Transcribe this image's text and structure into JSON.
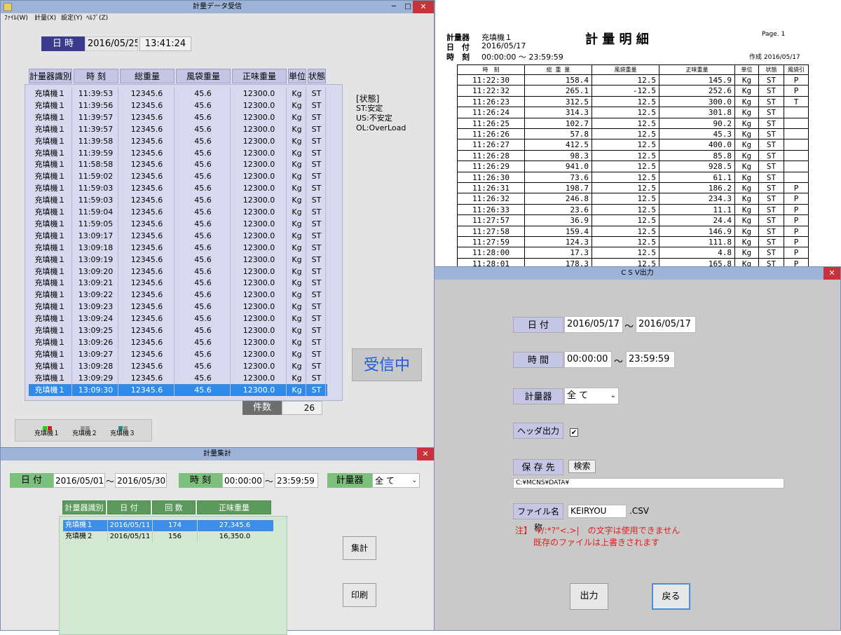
{
  "receive_window": {
    "title": "計量データ受信",
    "menu": [
      "ﾌｧｲﾙ(W)",
      "計量(X)",
      "設定(Y)",
      "ﾍﾙﾌﾟ(Z)"
    ],
    "datetime_label": "日 時",
    "date": "2016/05/25",
    "time": "13:41:24",
    "columns": [
      "計量器識別",
      "時 刻",
      "総重量",
      "風袋重量",
      "正味重量",
      "単位",
      "状態"
    ],
    "rows": [
      [
        "充填機１",
        "11:39:53",
        "12345.6",
        "45.6",
        "12300.0",
        "Kg",
        "ST"
      ],
      [
        "充填機１",
        "11:39:56",
        "12345.6",
        "45.6",
        "12300.0",
        "Kg",
        "ST"
      ],
      [
        "充填機１",
        "11:39:57",
        "12345.6",
        "45.6",
        "12300.0",
        "Kg",
        "ST"
      ],
      [
        "充填機１",
        "11:39:57",
        "12345.6",
        "45.6",
        "12300.0",
        "Kg",
        "ST"
      ],
      [
        "充填機１",
        "11:39:58",
        "12345.6",
        "45.6",
        "12300.0",
        "Kg",
        "ST"
      ],
      [
        "充填機１",
        "11:39:59",
        "12345.6",
        "45.6",
        "12300.0",
        "Kg",
        "ST"
      ],
      [
        "充填機１",
        "11:58:58",
        "12345.6",
        "45.6",
        "12300.0",
        "Kg",
        "ST"
      ],
      [
        "充填機１",
        "11:59:02",
        "12345.6",
        "45.6",
        "12300.0",
        "Kg",
        "ST"
      ],
      [
        "充填機１",
        "11:59:03",
        "12345.6",
        "45.6",
        "12300.0",
        "Kg",
        "ST"
      ],
      [
        "充填機１",
        "11:59:03",
        "12345.6",
        "45.6",
        "12300.0",
        "Kg",
        "ST"
      ],
      [
        "充填機１",
        "11:59:04",
        "12345.6",
        "45.6",
        "12300.0",
        "Kg",
        "ST"
      ],
      [
        "充填機１",
        "11:59:05",
        "12345.6",
        "45.6",
        "12300.0",
        "Kg",
        "ST"
      ],
      [
        "充填機１",
        "13:09:17",
        "12345.6",
        "45.6",
        "12300.0",
        "Kg",
        "ST"
      ],
      [
        "充填機１",
        "13:09:18",
        "12345.6",
        "45.6",
        "12300.0",
        "Kg",
        "ST"
      ],
      [
        "充填機１",
        "13:09:19",
        "12345.6",
        "45.6",
        "12300.0",
        "Kg",
        "ST"
      ],
      [
        "充填機１",
        "13:09:20",
        "12345.6",
        "45.6",
        "12300.0",
        "Kg",
        "ST"
      ],
      [
        "充填機１",
        "13:09:21",
        "12345.6",
        "45.6",
        "12300.0",
        "Kg",
        "ST"
      ],
      [
        "充填機１",
        "13:09:22",
        "12345.6",
        "45.6",
        "12300.0",
        "Kg",
        "ST"
      ],
      [
        "充填機１",
        "13:09:23",
        "12345.6",
        "45.6",
        "12300.0",
        "Kg",
        "ST"
      ],
      [
        "充填機１",
        "13:09:24",
        "12345.6",
        "45.6",
        "12300.0",
        "Kg",
        "ST"
      ],
      [
        "充填機１",
        "13:09:25",
        "12345.6",
        "45.6",
        "12300.0",
        "Kg",
        "ST"
      ],
      [
        "充填機１",
        "13:09:26",
        "12345.6",
        "45.6",
        "12300.0",
        "Kg",
        "ST"
      ],
      [
        "充填機１",
        "13:09:27",
        "12345.6",
        "45.6",
        "12300.0",
        "Kg",
        "ST"
      ],
      [
        "充填機１",
        "13:09:28",
        "12345.6",
        "45.6",
        "12300.0",
        "Kg",
        "ST"
      ],
      [
        "充填機１",
        "13:09:29",
        "12345.6",
        "45.6",
        "12300.0",
        "Kg",
        "ST"
      ],
      [
        "充填機１",
        "13:09:30",
        "12345.6",
        "45.6",
        "12300.0",
        "Kg",
        "ST"
      ]
    ],
    "selected_row": 25,
    "status_legend": [
      "[状態]",
      "ST:安定",
      "US:不安定",
      "OL:OverLoad"
    ],
    "count_label": "件数",
    "count_value": "26",
    "receiving_label": "受信中",
    "machines": [
      {
        "name": "充填機１",
        "color_a": "#22cc22",
        "color_b": "#cc2222"
      },
      {
        "name": "充填機２",
        "color_a": "#999999",
        "color_b": "#999999"
      },
      {
        "name": "充填機３",
        "color_a": "#228888",
        "color_b": "#999999"
      }
    ],
    "colors": {
      "selected": "#2f8ae8",
      "header": "#c5c5e5",
      "list_bg": "#d8d8ee",
      "label_bg": "#3a3a8e"
    }
  },
  "report": {
    "title": "計 量 明 細",
    "page": "Page. 1",
    "meter_label": "計量器",
    "meter_value": "充填機１",
    "date_label": "日　付",
    "date_value": "2016/05/17",
    "time_label": "時　刻",
    "time_value": "00:00:00 ～ 23:59:59",
    "created": "作成 2016/05/17",
    "columns": [
      "時　刻",
      "総 重 量",
      "風袋重量",
      "正味重量",
      "単位",
      "状態",
      "風袋引"
    ],
    "rows": [
      [
        "11:22:30",
        "158.4",
        "12.5",
        "145.9",
        "Kg",
        "ST",
        "P"
      ],
      [
        "11:22:32",
        "265.1",
        "-12.5",
        "252.6",
        "Kg",
        "ST",
        "P"
      ],
      [
        "11:26:23",
        "312.5",
        "12.5",
        "300.0",
        "Kg",
        "ST",
        "T"
      ],
      [
        "11:26:24",
        "314.3",
        "12.5",
        "301.8",
        "Kg",
        "ST",
        ""
      ],
      [
        "11:26:25",
        "102.7",
        "12.5",
        "90.2",
        "Kg",
        "ST",
        ""
      ],
      [
        "11:26:26",
        "57.8",
        "12.5",
        "45.3",
        "Kg",
        "ST",
        ""
      ],
      [
        "11:26:27",
        "412.5",
        "12.5",
        "400.0",
        "Kg",
        "ST",
        ""
      ],
      [
        "11:26:28",
        "98.3",
        "12.5",
        "85.8",
        "Kg",
        "ST",
        ""
      ],
      [
        "11:26:29",
        "941.0",
        "12.5",
        "928.5",
        "Kg",
        "ST",
        ""
      ],
      [
        "11:26:30",
        "73.6",
        "12.5",
        "61.1",
        "Kg",
        "ST",
        ""
      ],
      [
        "11:26:31",
        "198.7",
        "12.5",
        "186.2",
        "Kg",
        "ST",
        "P"
      ],
      [
        "11:26:32",
        "246.8",
        "12.5",
        "234.3",
        "Kg",
        "ST",
        "P"
      ],
      [
        "11:26:33",
        "23.6",
        "12.5",
        "11.1",
        "Kg",
        "ST",
        "P"
      ],
      [
        "11:27:57",
        "36.9",
        "12.5",
        "24.4",
        "Kg",
        "ST",
        "P"
      ],
      [
        "11:27:58",
        "159.4",
        "12.5",
        "146.9",
        "Kg",
        "ST",
        "P"
      ],
      [
        "11:27:59",
        "124.3",
        "12.5",
        "111.8",
        "Kg",
        "ST",
        "P"
      ],
      [
        "11:28:00",
        "17.3",
        "12.5",
        "4.8",
        "Kg",
        "ST",
        "P"
      ],
      [
        "11:28:01",
        "178.3",
        "12.5",
        "165.8",
        "Kg",
        "ST",
        "P"
      ]
    ]
  },
  "summary": {
    "title": "計量集計",
    "date_label": "日 付",
    "date_from": "2016/05/01",
    "date_to": "2016/05/30",
    "time_label": "時 刻",
    "time_from": "00:00:00",
    "time_to": "23:59:59",
    "meter_label": "計量器",
    "meter_value": "全 て",
    "tilde": "～",
    "columns": [
      "計量器識別",
      "日 付",
      "回 数",
      "正味重量"
    ],
    "rows": [
      [
        "充填機１",
        "2016/05/11",
        "174",
        "27,345.6"
      ],
      [
        "充填機２",
        "2016/05/11",
        "156",
        "16,350.0"
      ]
    ],
    "aggregate_button": "集計",
    "print_button": "印刷",
    "colors": {
      "label_bg": "#7dbf7d",
      "list_bg": "#d3e8d3",
      "selected": "#3d8ee8"
    }
  },
  "csv": {
    "title": "C S V出力",
    "date_label": "日 付",
    "date_from": "2016/05/17",
    "date_to": "2016/05/17",
    "time_label": "時 間",
    "time_from": "00:00:00",
    "time_to": "23:59:59",
    "meter_label": "計量器",
    "meter_value": "全 て",
    "header_label": "ヘッダ出力",
    "header_checked": "✔",
    "save_label": "保 存 先",
    "search_button": "検索",
    "save_path": "C:¥MCNS¥DATA¥",
    "filename_label": "ファイル名称",
    "filename_value": "KEIRYOU",
    "extension": ".CSV",
    "note_1": "注】　¥/:*?\"<.>|　の文字は使用できません",
    "note_2": "既存のファイルは上書きされます",
    "output_button": "出力",
    "back_button": "戻る",
    "tilde": "～",
    "colors": {
      "label_bg": "#c5c5e5",
      "note": "#e02020"
    }
  }
}
